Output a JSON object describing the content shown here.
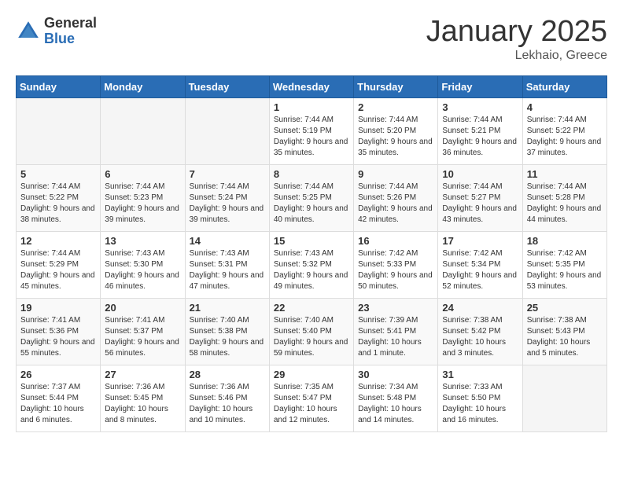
{
  "header": {
    "logo_general": "General",
    "logo_blue": "Blue",
    "month_title": "January 2025",
    "location": "Lekhaio, Greece"
  },
  "weekdays": [
    "Sunday",
    "Monday",
    "Tuesday",
    "Wednesday",
    "Thursday",
    "Friday",
    "Saturday"
  ],
  "weeks": [
    [
      {
        "day": "",
        "info": ""
      },
      {
        "day": "",
        "info": ""
      },
      {
        "day": "",
        "info": ""
      },
      {
        "day": "1",
        "info": "Sunrise: 7:44 AM\nSunset: 5:19 PM\nDaylight: 9 hours and 35 minutes."
      },
      {
        "day": "2",
        "info": "Sunrise: 7:44 AM\nSunset: 5:20 PM\nDaylight: 9 hours and 35 minutes."
      },
      {
        "day": "3",
        "info": "Sunrise: 7:44 AM\nSunset: 5:21 PM\nDaylight: 9 hours and 36 minutes."
      },
      {
        "day": "4",
        "info": "Sunrise: 7:44 AM\nSunset: 5:22 PM\nDaylight: 9 hours and 37 minutes."
      }
    ],
    [
      {
        "day": "5",
        "info": "Sunrise: 7:44 AM\nSunset: 5:22 PM\nDaylight: 9 hours and 38 minutes."
      },
      {
        "day": "6",
        "info": "Sunrise: 7:44 AM\nSunset: 5:23 PM\nDaylight: 9 hours and 39 minutes."
      },
      {
        "day": "7",
        "info": "Sunrise: 7:44 AM\nSunset: 5:24 PM\nDaylight: 9 hours and 39 minutes."
      },
      {
        "day": "8",
        "info": "Sunrise: 7:44 AM\nSunset: 5:25 PM\nDaylight: 9 hours and 40 minutes."
      },
      {
        "day": "9",
        "info": "Sunrise: 7:44 AM\nSunset: 5:26 PM\nDaylight: 9 hours and 42 minutes."
      },
      {
        "day": "10",
        "info": "Sunrise: 7:44 AM\nSunset: 5:27 PM\nDaylight: 9 hours and 43 minutes."
      },
      {
        "day": "11",
        "info": "Sunrise: 7:44 AM\nSunset: 5:28 PM\nDaylight: 9 hours and 44 minutes."
      }
    ],
    [
      {
        "day": "12",
        "info": "Sunrise: 7:44 AM\nSunset: 5:29 PM\nDaylight: 9 hours and 45 minutes."
      },
      {
        "day": "13",
        "info": "Sunrise: 7:43 AM\nSunset: 5:30 PM\nDaylight: 9 hours and 46 minutes."
      },
      {
        "day": "14",
        "info": "Sunrise: 7:43 AM\nSunset: 5:31 PM\nDaylight: 9 hours and 47 minutes."
      },
      {
        "day": "15",
        "info": "Sunrise: 7:43 AM\nSunset: 5:32 PM\nDaylight: 9 hours and 49 minutes."
      },
      {
        "day": "16",
        "info": "Sunrise: 7:42 AM\nSunset: 5:33 PM\nDaylight: 9 hours and 50 minutes."
      },
      {
        "day": "17",
        "info": "Sunrise: 7:42 AM\nSunset: 5:34 PM\nDaylight: 9 hours and 52 minutes."
      },
      {
        "day": "18",
        "info": "Sunrise: 7:42 AM\nSunset: 5:35 PM\nDaylight: 9 hours and 53 minutes."
      }
    ],
    [
      {
        "day": "19",
        "info": "Sunrise: 7:41 AM\nSunset: 5:36 PM\nDaylight: 9 hours and 55 minutes."
      },
      {
        "day": "20",
        "info": "Sunrise: 7:41 AM\nSunset: 5:37 PM\nDaylight: 9 hours and 56 minutes."
      },
      {
        "day": "21",
        "info": "Sunrise: 7:40 AM\nSunset: 5:38 PM\nDaylight: 9 hours and 58 minutes."
      },
      {
        "day": "22",
        "info": "Sunrise: 7:40 AM\nSunset: 5:40 PM\nDaylight: 9 hours and 59 minutes."
      },
      {
        "day": "23",
        "info": "Sunrise: 7:39 AM\nSunset: 5:41 PM\nDaylight: 10 hours and 1 minute."
      },
      {
        "day": "24",
        "info": "Sunrise: 7:38 AM\nSunset: 5:42 PM\nDaylight: 10 hours and 3 minutes."
      },
      {
        "day": "25",
        "info": "Sunrise: 7:38 AM\nSunset: 5:43 PM\nDaylight: 10 hours and 5 minutes."
      }
    ],
    [
      {
        "day": "26",
        "info": "Sunrise: 7:37 AM\nSunset: 5:44 PM\nDaylight: 10 hours and 6 minutes."
      },
      {
        "day": "27",
        "info": "Sunrise: 7:36 AM\nSunset: 5:45 PM\nDaylight: 10 hours and 8 minutes."
      },
      {
        "day": "28",
        "info": "Sunrise: 7:36 AM\nSunset: 5:46 PM\nDaylight: 10 hours and 10 minutes."
      },
      {
        "day": "29",
        "info": "Sunrise: 7:35 AM\nSunset: 5:47 PM\nDaylight: 10 hours and 12 minutes."
      },
      {
        "day": "30",
        "info": "Sunrise: 7:34 AM\nSunset: 5:48 PM\nDaylight: 10 hours and 14 minutes."
      },
      {
        "day": "31",
        "info": "Sunrise: 7:33 AM\nSunset: 5:50 PM\nDaylight: 10 hours and 16 minutes."
      },
      {
        "day": "",
        "info": ""
      }
    ]
  ]
}
